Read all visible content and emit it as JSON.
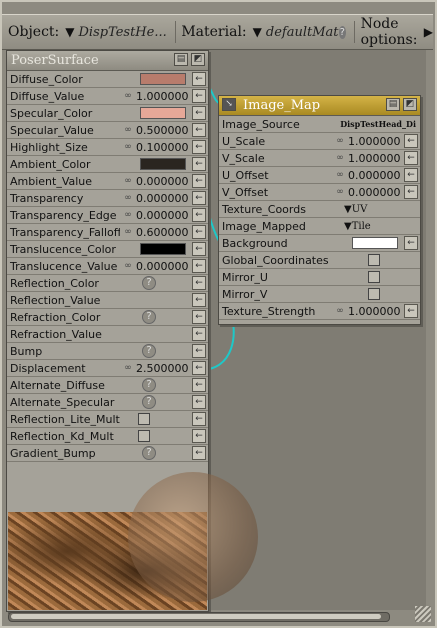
{
  "topbar": {
    "object_label": "Object:",
    "object_value": "DispTestHe...",
    "material_label": "Material:",
    "material_value": "defaultMat",
    "node_options_label": "Node options:"
  },
  "poser_surface": {
    "title": "PoserSurface",
    "rows": [
      {
        "name": "Diffuse_Color",
        "kind": "color",
        "color": "#b87c6c"
      },
      {
        "name": "Diffuse_Value",
        "kind": "num",
        "value": "1.000000"
      },
      {
        "name": "Specular_Color",
        "kind": "color",
        "color": "#e6a898"
      },
      {
        "name": "Specular_Value",
        "kind": "num",
        "value": "0.500000"
      },
      {
        "name": "Highlight_Size",
        "kind": "num",
        "value": "0.100000"
      },
      {
        "name": "Ambient_Color",
        "kind": "color",
        "color": "#2a2520"
      },
      {
        "name": "Ambient_Value",
        "kind": "num",
        "value": "0.000000"
      },
      {
        "name": "Transparency",
        "kind": "num",
        "value": "0.000000"
      },
      {
        "name": "Transparency_Edge",
        "kind": "num",
        "value": "0.000000"
      },
      {
        "name": "Transparency_Falloff",
        "kind": "num",
        "value": "0.600000"
      },
      {
        "name": "Translucence_Color",
        "kind": "color",
        "color": "#000000"
      },
      {
        "name": "Translucence_Value",
        "kind": "num",
        "value": "0.000000"
      },
      {
        "name": "Reflection_Color",
        "kind": "help"
      },
      {
        "name": "Reflection_Value",
        "kind": "empty"
      },
      {
        "name": "Refraction_Color",
        "kind": "help"
      },
      {
        "name": "Refraction_Value",
        "kind": "empty"
      },
      {
        "name": "Bump",
        "kind": "help"
      },
      {
        "name": "Displacement",
        "kind": "num",
        "value": "2.500000"
      },
      {
        "name": "Alternate_Diffuse",
        "kind": "help"
      },
      {
        "name": "Alternate_Specular",
        "kind": "help"
      },
      {
        "name": "Reflection_Lite_Mult",
        "kind": "check"
      },
      {
        "name": "Reflection_Kd_Mult",
        "kind": "check"
      },
      {
        "name": "Gradient_Bump",
        "kind": "help"
      }
    ]
  },
  "image_map": {
    "title": "Image_Map",
    "rows": [
      {
        "name": "Image_Source",
        "kind": "text",
        "value": "DispTestHead_Di"
      },
      {
        "name": "U_Scale",
        "kind": "num",
        "value": "1.000000"
      },
      {
        "name": "V_Scale",
        "kind": "num",
        "value": "1.000000"
      },
      {
        "name": "U_Offset",
        "kind": "num",
        "value": "0.000000"
      },
      {
        "name": "V_Offset",
        "kind": "num",
        "value": "0.000000"
      },
      {
        "name": "Texture_Coords",
        "kind": "select",
        "value": "UV"
      },
      {
        "name": "Image_Mapped",
        "kind": "select",
        "value": "Tile"
      },
      {
        "name": "Background",
        "kind": "color",
        "color": "#ffffff"
      },
      {
        "name": "Global_Coordinates",
        "kind": "check"
      },
      {
        "name": "Mirror_U",
        "kind": "check"
      },
      {
        "name": "Mirror_V",
        "kind": "check"
      },
      {
        "name": "Texture_Strength",
        "kind": "num",
        "value": "1.000000"
      }
    ]
  },
  "colors": {
    "wire": "#1ec8c8",
    "image_map_title": "#c9a836"
  },
  "help_glyph": "?",
  "plug_glyph": "←",
  "link_glyph": "∞"
}
